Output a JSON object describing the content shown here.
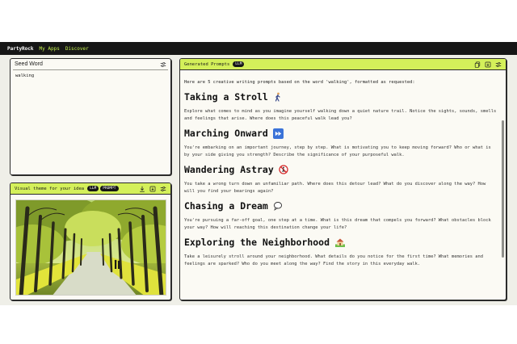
{
  "nav": {
    "brand": "PartyRock",
    "links": [
      "My Apps",
      "Discover"
    ]
  },
  "seed_panel": {
    "title": "Seed Word",
    "value": "walking"
  },
  "visual_panel": {
    "title": "Visual theme for your idea",
    "badges": [
      "LLM",
      "PROMPT"
    ]
  },
  "generated_panel": {
    "title": "Generated Prompts",
    "badge": "LLM",
    "intro": "Here are 5 creative writing prompts based on the word 'walking', formatted as requested:",
    "prompts": [
      {
        "title": "Taking a Stroll",
        "emoji": "person-walking-icon",
        "text": "Explore what comes to mind as you imagine yourself walking down a quiet nature trail. Notice the sights, sounds, smells and feelings that arise. Where does this peaceful walk lead you?"
      },
      {
        "title": "Marching Onward",
        "emoji": "fast-forward-icon",
        "text": "You're embarking on an important journey, step by step. What is motivating you to keep moving forward? Who or what is by your side giving you strength? Describe the significance of your purposeful walk."
      },
      {
        "title": "Wandering Astray",
        "emoji": "no-pedestrians-icon",
        "text": "You take a wrong turn down an unfamiliar path. Where does this detour lead? What do you discover along the way? How will you find your bearings again?"
      },
      {
        "title": "Chasing a Dream",
        "emoji": "speech-bubble-icon",
        "text": "You're pursuing a far-off goal, one step at a time. What is this dream that compels you forward? What obstacles block your way? How will reaching this destination change your life?"
      },
      {
        "title": "Exploring the Neighborhood",
        "emoji": "house-icon",
        "text": "Take a leisurely stroll around your neighborhood. What details do you notice for the first time? What memories and feelings are sparked? Who do you meet along the way? Find the story in this everyday walk."
      }
    ]
  },
  "colors": {
    "accent": "#d4f05a",
    "nav_bg": "#161616",
    "nav_link": "#c6f24e",
    "panel_bg": "#fbfaf4",
    "page_bg": "#efefe8"
  }
}
